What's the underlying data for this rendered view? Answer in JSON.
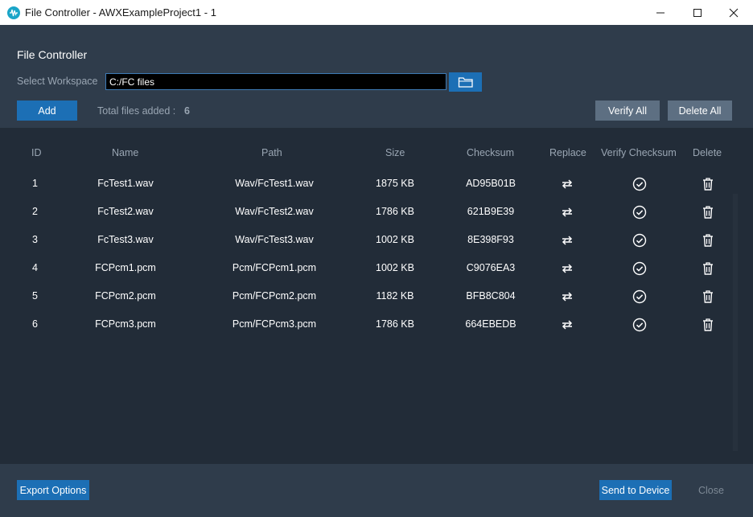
{
  "window": {
    "title": "File Controller - AWXExampleProject1 - 1",
    "controls": [
      "minimize-icon",
      "maximize-icon",
      "close-icon"
    ]
  },
  "header": {
    "section_title": "File Controller",
    "workspace_label": "Select Workspace",
    "workspace_value": "C:/FC files",
    "browse_icon": "folder-icon",
    "add_label": "Add",
    "total_label": "Total files added :",
    "total_value": "6",
    "verify_all_label": "Verify All",
    "delete_all_label": "Delete All"
  },
  "table": {
    "columns": [
      "ID",
      "Name",
      "Path",
      "Size",
      "Checksum",
      "Replace",
      "Verify Checksum",
      "Delete"
    ],
    "rows": [
      {
        "id": "1",
        "name": "FcTest1.wav",
        "path": "Wav/FcTest1.wav",
        "size": "1875 KB",
        "checksum": "AD95B01B"
      },
      {
        "id": "2",
        "name": "FcTest2.wav",
        "path": "Wav/FcTest2.wav",
        "size": "1786 KB",
        "checksum": "621B9E39"
      },
      {
        "id": "3",
        "name": "FcTest3.wav",
        "path": "Wav/FcTest3.wav",
        "size": "1002 KB",
        "checksum": "8E398F93"
      },
      {
        "id": "4",
        "name": "FCPcm1.pcm",
        "path": "Pcm/FCPcm1.pcm",
        "size": "1002 KB",
        "checksum": "C9076EA3"
      },
      {
        "id": "5",
        "name": "FCPcm2.pcm",
        "path": "Pcm/FCPcm2.pcm",
        "size": "1182 KB",
        "checksum": "BFB8C804"
      },
      {
        "id": "6",
        "name": "FCPcm3.pcm",
        "path": "Pcm/FCPcm3.pcm",
        "size": "1786 KB",
        "checksum": "664EBEDB"
      }
    ],
    "row_icons": {
      "replace": "swap-arrows-icon",
      "verify": "check-circle-icon",
      "delete": "trash-icon"
    }
  },
  "footer": {
    "export_label": "Export Options",
    "send_label": "Send to Device",
    "close_label": "Close"
  },
  "colors": {
    "accent": "#1c6fb5",
    "panel": "#2f3c4b",
    "table_bg": "#222c38",
    "muted_text": "#9aa6b3"
  }
}
